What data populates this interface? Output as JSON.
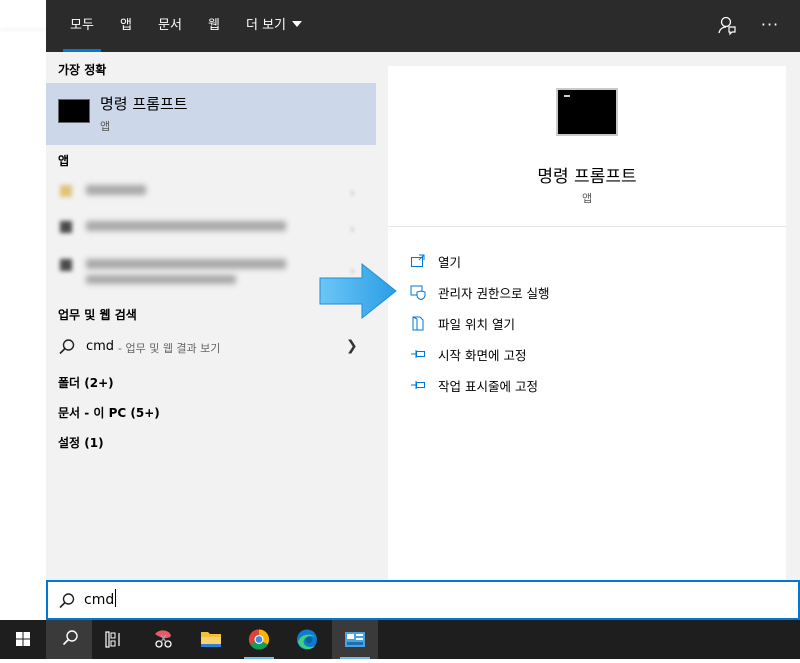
{
  "tabs": [
    {
      "label": "모두",
      "active": true
    },
    {
      "label": "앱"
    },
    {
      "label": "문서"
    },
    {
      "label": "웹"
    },
    {
      "label": "더 보기"
    }
  ],
  "toolbar": {
    "more_icon": "···",
    "feedback_icon": "feedback-icon"
  },
  "left": {
    "best_match_header": "가장 정확",
    "best_match": {
      "title": "명령 프롬프트",
      "subtitle": "앱"
    },
    "apps_header": "앱",
    "web_header": "업무 및 웹 검색",
    "web_result": {
      "query": "cmd",
      "suffix": " - 업무 및 웹 결과 보기"
    },
    "categories": [
      "폴더 (2+)",
      "문서 - 이 PC (5+)",
      "설정 (1)"
    ]
  },
  "detail": {
    "title": "명령 프롬프트",
    "subtitle": "앱",
    "actions": [
      {
        "label": "열기",
        "icon": "open-icon"
      },
      {
        "label": "관리자 권한으로 실행",
        "icon": "shield-icon"
      },
      {
        "label": "파일 위치 열기",
        "icon": "file-icon"
      },
      {
        "label": "시작 화면에 고정",
        "icon": "pin-icon"
      },
      {
        "label": "작업 표시줄에 고정",
        "icon": "pin-icon"
      }
    ]
  },
  "search": {
    "value": "cmd"
  },
  "colors": {
    "accent": "#0078d7",
    "highlight": "#cdd7ea",
    "topbar": "#2b2b2b",
    "arrow": "#39a7ea"
  },
  "taskbar_icons": [
    "windows-start-icon",
    "search-icon",
    "task-view-icon",
    "snip-sketch-icon",
    "file-explorer-icon",
    "chrome-icon",
    "edge-icon",
    "control-panel-icon"
  ]
}
